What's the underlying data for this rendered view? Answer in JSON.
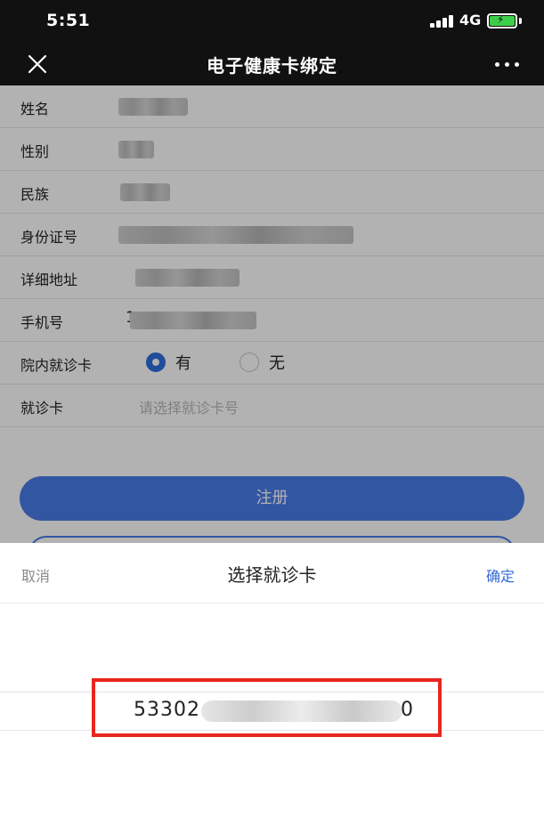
{
  "status_bar": {
    "time": "5:51",
    "network": "4G",
    "battery_color": "#3ecf4a"
  },
  "nav": {
    "close_icon": "close-icon",
    "title": "电子健康卡绑定",
    "more_icon": "more-icon"
  },
  "form": {
    "fields": [
      {
        "label": "姓名"
      },
      {
        "label": "性别"
      },
      {
        "label": "民族"
      },
      {
        "label": "身份证号"
      },
      {
        "label": "详细地址"
      },
      {
        "label": "手机号",
        "lead": "1"
      }
    ],
    "clinic_card": {
      "label": "院内就诊卡",
      "option_yes": "有",
      "option_no": "无",
      "selected": "有"
    },
    "visit_card": {
      "label": "就诊卡",
      "placeholder": "请选择就诊卡号"
    },
    "register_label": "注册"
  },
  "sheet": {
    "cancel_label": "取消",
    "title": "选择就诊卡",
    "confirm_label": "确定",
    "option_visible_start": "53302",
    "option_visible_end": "0"
  },
  "colors": {
    "accent": "#4a7ce8",
    "highlight": "#e8261e",
    "confirm": "#3569d6"
  }
}
